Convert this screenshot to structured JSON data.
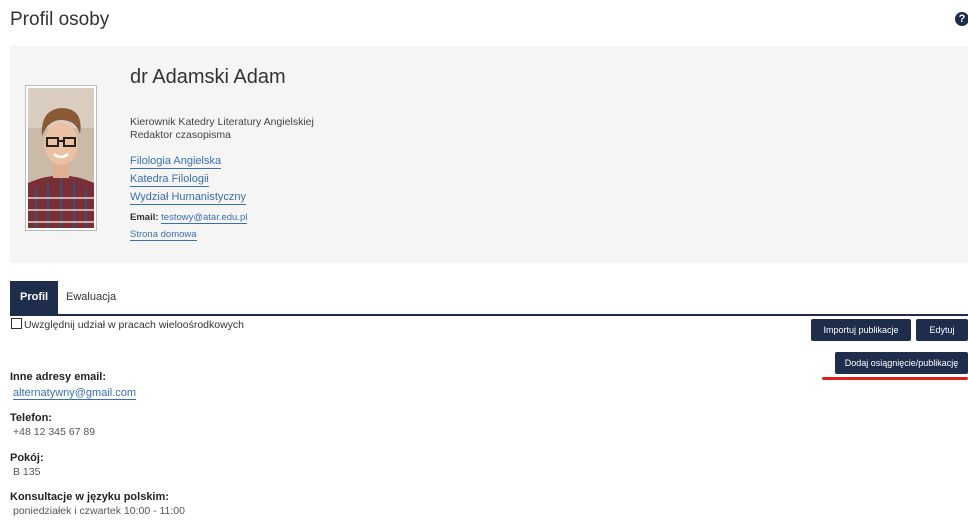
{
  "page": {
    "title": "Profil osoby",
    "help_icon": "question-circle-icon"
  },
  "profile": {
    "name": "dr Adamski Adam",
    "roles": [
      "Kierownik Katedry Literatury Angielskiej",
      "Redaktor czasopisma"
    ],
    "units": [
      "Filologia Angielska",
      "Katedra Filologii",
      "Wydział Humanistyczny"
    ],
    "email_label": "Email:",
    "email": "testowy@atar.edu.pl",
    "homepage": "Strona domowa"
  },
  "tabs": [
    {
      "label": "Profil",
      "active": true
    },
    {
      "label": "Ewaluacja",
      "active": false
    }
  ],
  "multicenter_checkbox": {
    "label": "Uwzględnij udział w pracach wieloośrodkowych",
    "checked": false
  },
  "buttons": {
    "import": "Importuj publikacje",
    "edit": "Edytuj",
    "add": "Dodaj osiągnięcie/publikację"
  },
  "details": {
    "other_emails_label": "Inne adresy email:",
    "other_emails_value": "alternatywny@gmail.com",
    "phone_label": "Telefon:",
    "phone_value": "+48 12 345 67 89",
    "room_label": "Pokój:",
    "room_value": "B 135",
    "consult_label": "Konsultacje w języku polskim:",
    "consult_value": "poniedziałek i czwartek 10:00 - 11:00"
  },
  "colors": {
    "navy": "#1f2d4d",
    "link": "#3a6fb0",
    "highlight": "#e02020"
  }
}
